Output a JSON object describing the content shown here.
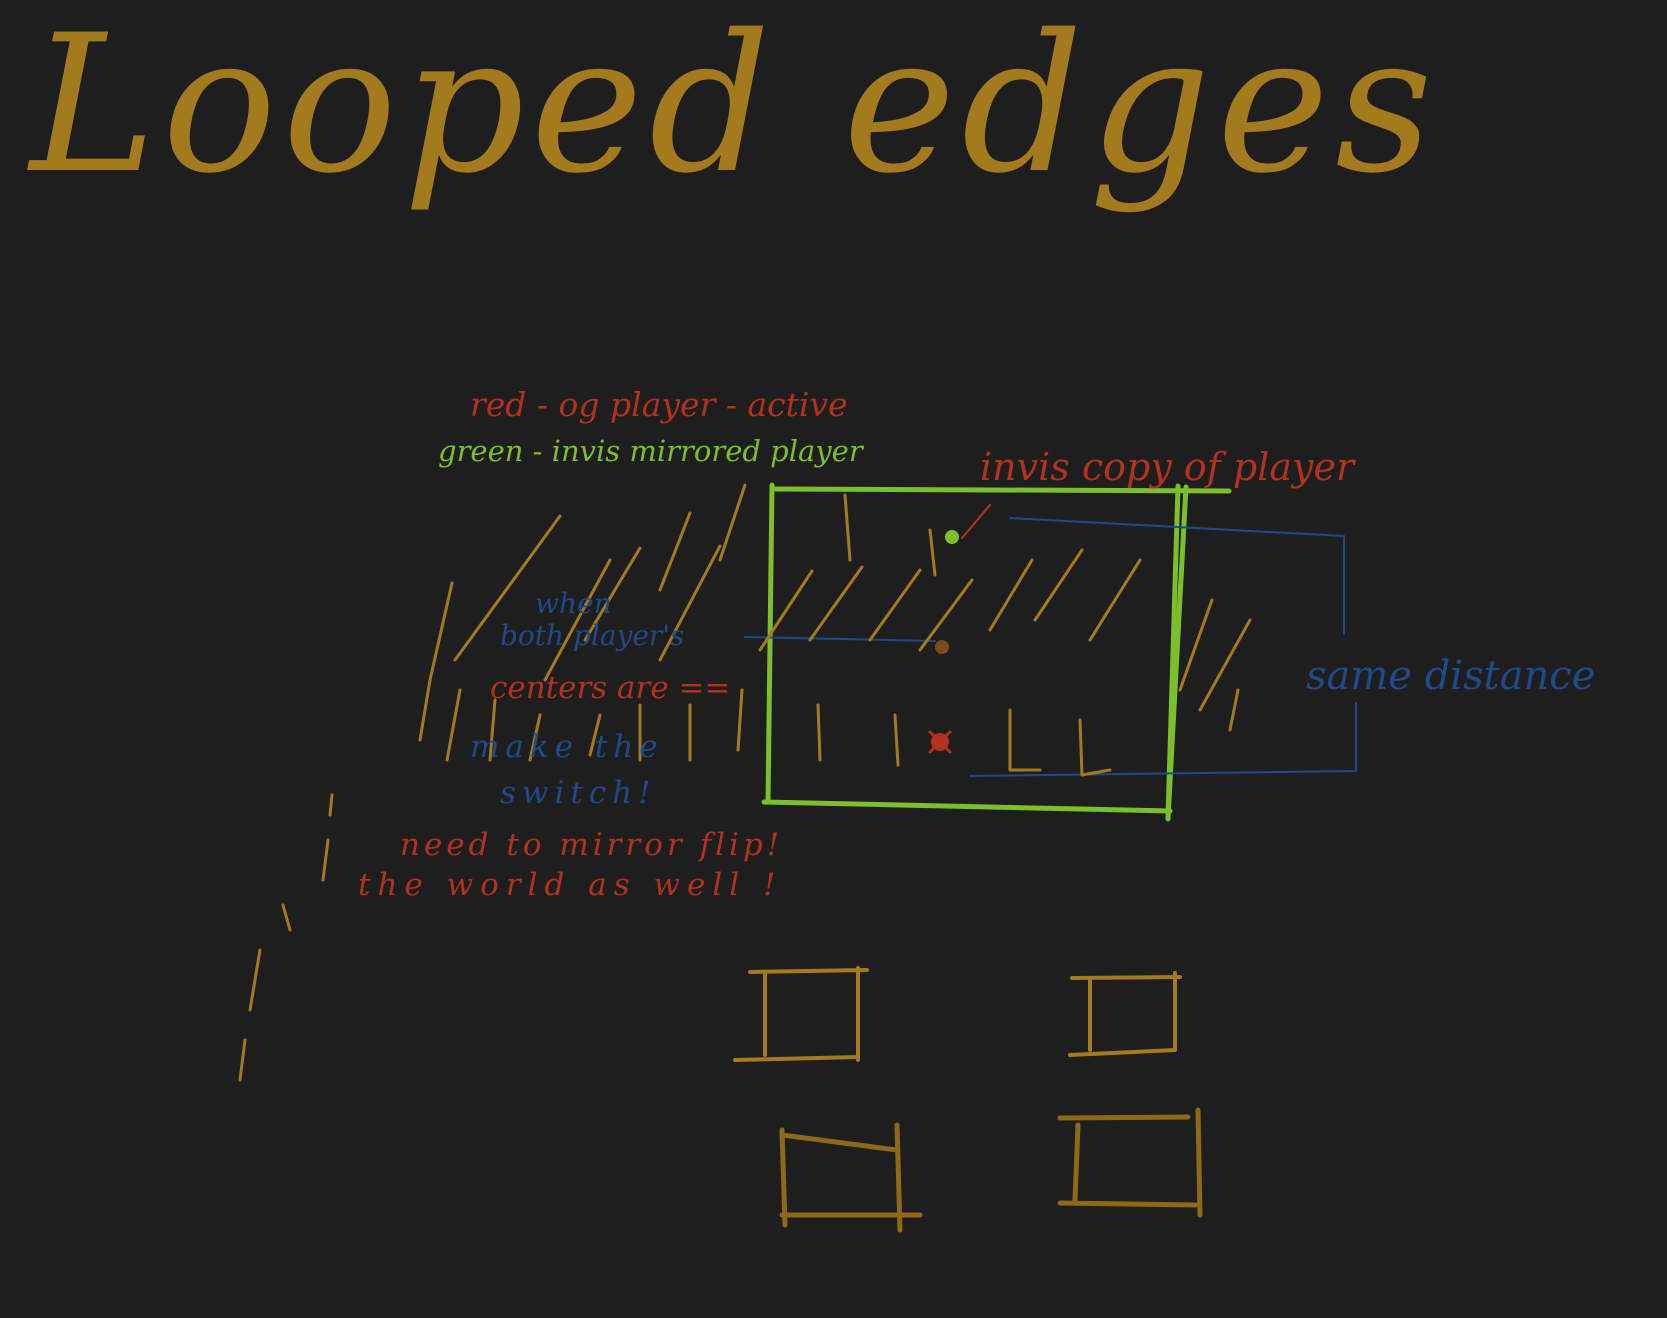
{
  "title": "Looped edges",
  "legend": {
    "red": "red - og player - active",
    "green": "green - invis mirrored player"
  },
  "labels": {
    "copy": "invis copy of player",
    "distance": "same distance"
  },
  "note": {
    "line1": "when",
    "line2": "both player's",
    "line3": "centers are ==",
    "line4": "make the",
    "line5": "switch!"
  },
  "warning": {
    "line1": "need to mirror flip!",
    "line2": "the world as well !"
  },
  "colors": {
    "background": "#1e1e1e",
    "ink_gold": "#a47a1e",
    "ink_dark_gold": "#8e6a18",
    "ink_green": "#7bbf2a",
    "ink_red": "#b2321f",
    "ink_blue": "#1f4a8a",
    "dot_brown": "#7a4a1a"
  }
}
